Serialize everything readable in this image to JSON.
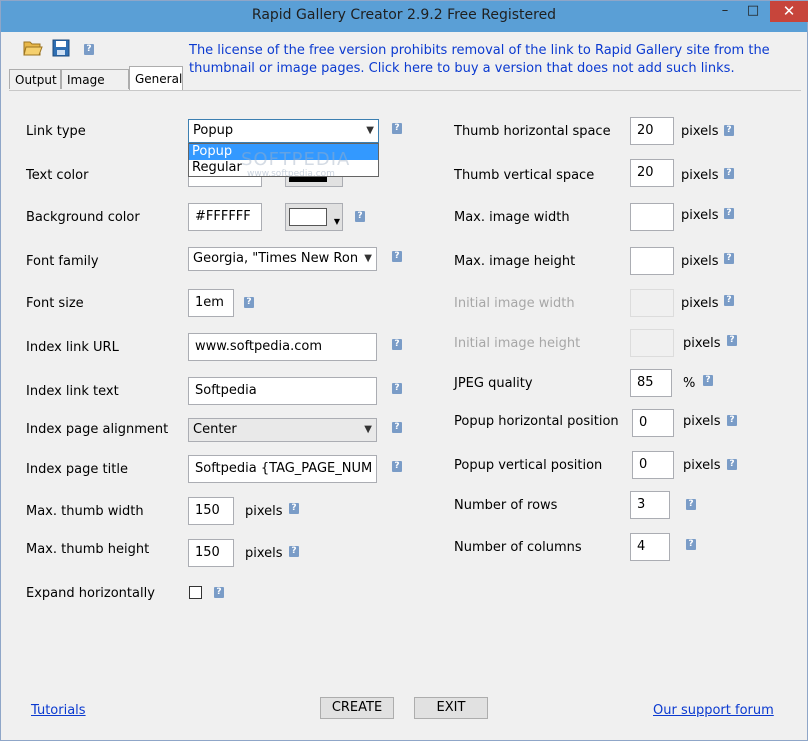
{
  "window": {
    "title": "Rapid Gallery Creator 2.9.2 Free Registered",
    "minimize": "–",
    "maximize": "□",
    "close": "✕"
  },
  "toolbar": {
    "open_icon": "folder-open-icon",
    "save_icon": "save-disk-icon",
    "help_icon": "help-icon",
    "help_glyph": "?"
  },
  "notice": "The license of the free version prohibits removal of the link to Rapid Gallery site from the thumbnail or image pages. Click here to buy a version that does not add such links.",
  "tabs": [
    {
      "label": "Output"
    },
    {
      "label": "Image files"
    },
    {
      "label": "General"
    }
  ],
  "left": {
    "link_type": {
      "label": "Link type",
      "value": "Popup"
    },
    "text_color": {
      "label": "Text color"
    },
    "background_color": {
      "label": "Background color",
      "value": "#FFFFFF"
    },
    "font_family": {
      "label": "Font family",
      "value": "Georgia, \"Times New Ron"
    },
    "font_size": {
      "label": "Font size",
      "value": "1em"
    },
    "index_link_url": {
      "label": "Index link URL",
      "value": "www.softpedia.com"
    },
    "index_link_text": {
      "label": "Index link text",
      "value": "Softpedia"
    },
    "index_page_alignment": {
      "label": "Index page alignment",
      "value": "Center"
    },
    "index_page_title": {
      "label": "Index page title",
      "value": "Softpedia {TAG_PAGE_NUM"
    },
    "max_thumb_width": {
      "label": "Max. thumb width",
      "value": "150",
      "unit": "pixels"
    },
    "max_thumb_height": {
      "label": "Max. thumb height",
      "value": "150",
      "unit": "pixels"
    },
    "expand_horizontally": {
      "label": "Expand horizontally",
      "checked": false
    }
  },
  "right": {
    "thumb_h_space": {
      "label": "Thumb horizontal space",
      "value": "20",
      "unit": "pixels"
    },
    "thumb_v_space": {
      "label": "Thumb vertical space",
      "value": "20",
      "unit": "pixels"
    },
    "max_image_width": {
      "label": "Max. image width",
      "value": "",
      "unit": "pixels"
    },
    "max_image_height": {
      "label": "Max. image height",
      "value": "",
      "unit": "pixels"
    },
    "initial_image_width": {
      "label": "Initial image width",
      "value": "",
      "unit": "pixels"
    },
    "initial_image_height": {
      "label": "Initial image height",
      "value": "",
      "unit": "pixels"
    },
    "jpeg_quality": {
      "label": "JPEG quality",
      "value": "85",
      "unit": "%"
    },
    "popup_h_position": {
      "label": "Popup horizontal position",
      "value": "0",
      "unit": "pixels"
    },
    "popup_v_position": {
      "label": "Popup vertical position",
      "value": "0",
      "unit": "pixels"
    },
    "number_of_rows": {
      "label": "Number of rows",
      "value": "3"
    },
    "number_of_columns": {
      "label": "Number of columns",
      "value": "4"
    }
  },
  "dropdown": {
    "options": [
      "Popup",
      "Regular"
    ],
    "highlighted": "Popup"
  },
  "watermark": {
    "text": "SOFTPEDIA",
    "sub": "www.softpedia.com"
  },
  "footer": {
    "tutorials": "Tutorials",
    "create": "CREATE",
    "exit": "EXIT",
    "support": "Our support forum"
  },
  "colors": {
    "accent_link": "#0b3ad0",
    "titlebar": "#5a9fd6",
    "close": "#c7453b",
    "highlight": "#3399ff"
  }
}
